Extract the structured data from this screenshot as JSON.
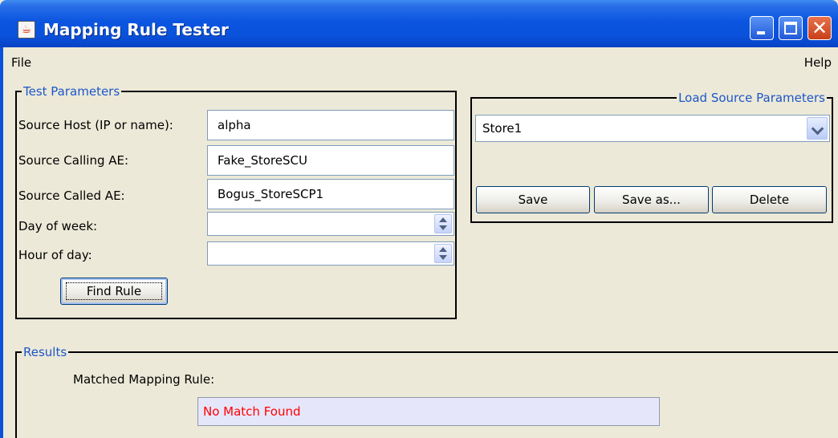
{
  "window": {
    "title": "Mapping Rule Tester",
    "app_icon_glyph": "☕"
  },
  "menubar": {
    "file": "File",
    "help": "Help"
  },
  "test_params": {
    "group_title": "Test Parameters",
    "source_host_label": "Source Host (IP or name):",
    "source_host_value": "alpha",
    "calling_ae_label": "Source Calling AE:",
    "calling_ae_value": "Fake_StoreSCU",
    "called_ae_label": "Source Called AE:",
    "called_ae_value": "Bogus_StoreSCP1",
    "day_of_week_label": "Day of week:",
    "day_of_week_value": "",
    "hour_of_day_label": "Hour of day:",
    "hour_of_day_value": "",
    "find_rule_label": "Find Rule"
  },
  "load_source": {
    "group_title": "Load Source Parameters",
    "selected": "Store1",
    "save_label": "Save",
    "save_as_label": "Save as...",
    "delete_label": "Delete"
  },
  "results": {
    "group_title": "Results",
    "matched_label": "Matched Mapping Rule:",
    "matched_value": "No Match Found",
    "matched_color": "#ff0000"
  },
  "colors": {
    "titlebar": "#0a52db",
    "group_title": "#1d56c8",
    "window_bg": "#ece9d8"
  }
}
